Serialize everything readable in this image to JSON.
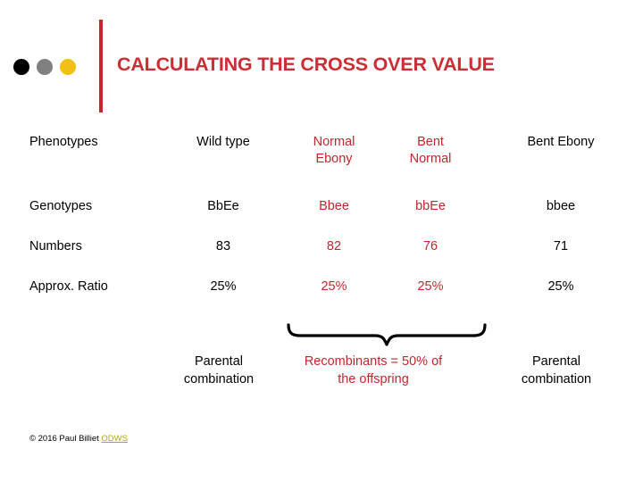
{
  "header": {
    "title": "CALCULATING THE CROSS OVER VALUE",
    "accent_color": "#CC2E35",
    "rule_color": "#C1272D",
    "dots": [
      {
        "name": "dot-black",
        "color": "#000000"
      },
      {
        "name": "dot-gray",
        "color": "#808080"
      },
      {
        "name": "dot-gold",
        "color": "#F2C014"
      }
    ]
  },
  "table": {
    "row_labels": [
      "Phenotypes",
      "Genotypes",
      "Numbers",
      "Approx. Ratio"
    ],
    "columns": [
      {
        "key": "wild_type",
        "highlight": false
      },
      {
        "key": "normal_ebony",
        "highlight": true
      },
      {
        "key": "bent_normal",
        "highlight": true
      },
      {
        "key": "bent_ebony",
        "highlight": false
      }
    ],
    "phenotypes": {
      "label": "Phenotypes",
      "wild_type": "Wild type",
      "normal_ebony_line1": "Normal",
      "normal_ebony_line2": "Ebony",
      "bent_normal_line1": "Bent",
      "bent_normal_line2": "Normal",
      "bent_ebony": "Bent Ebony"
    },
    "genotypes": {
      "label": "Genotypes",
      "wild_type": "BbEe",
      "normal_ebony": "Bbee",
      "bent_normal": "bbEe",
      "bent_ebony": "bbee"
    },
    "numbers": {
      "label": "Numbers",
      "wild_type": "83",
      "normal_ebony": "82",
      "bent_normal": "76",
      "bent_ebony": "71"
    },
    "ratio": {
      "label": "Approx. Ratio",
      "wild_type": "25%",
      "normal_ebony": "25%",
      "bent_normal": "25%",
      "bent_ebony": "25%"
    },
    "highlight_color": "#C1272D"
  },
  "captions": {
    "left_line1": "Parental",
    "left_line2": "combination",
    "middle_line1": "Recombinants = 50% of",
    "middle_line2": "the offspring",
    "right_line1": "Parental",
    "right_line2": "combination",
    "middle_color": "#C1272D"
  },
  "footer": {
    "copyright": "© 2016 Paul Billiet ",
    "link_label": "ODWS",
    "link_color": "#B5A11C"
  }
}
